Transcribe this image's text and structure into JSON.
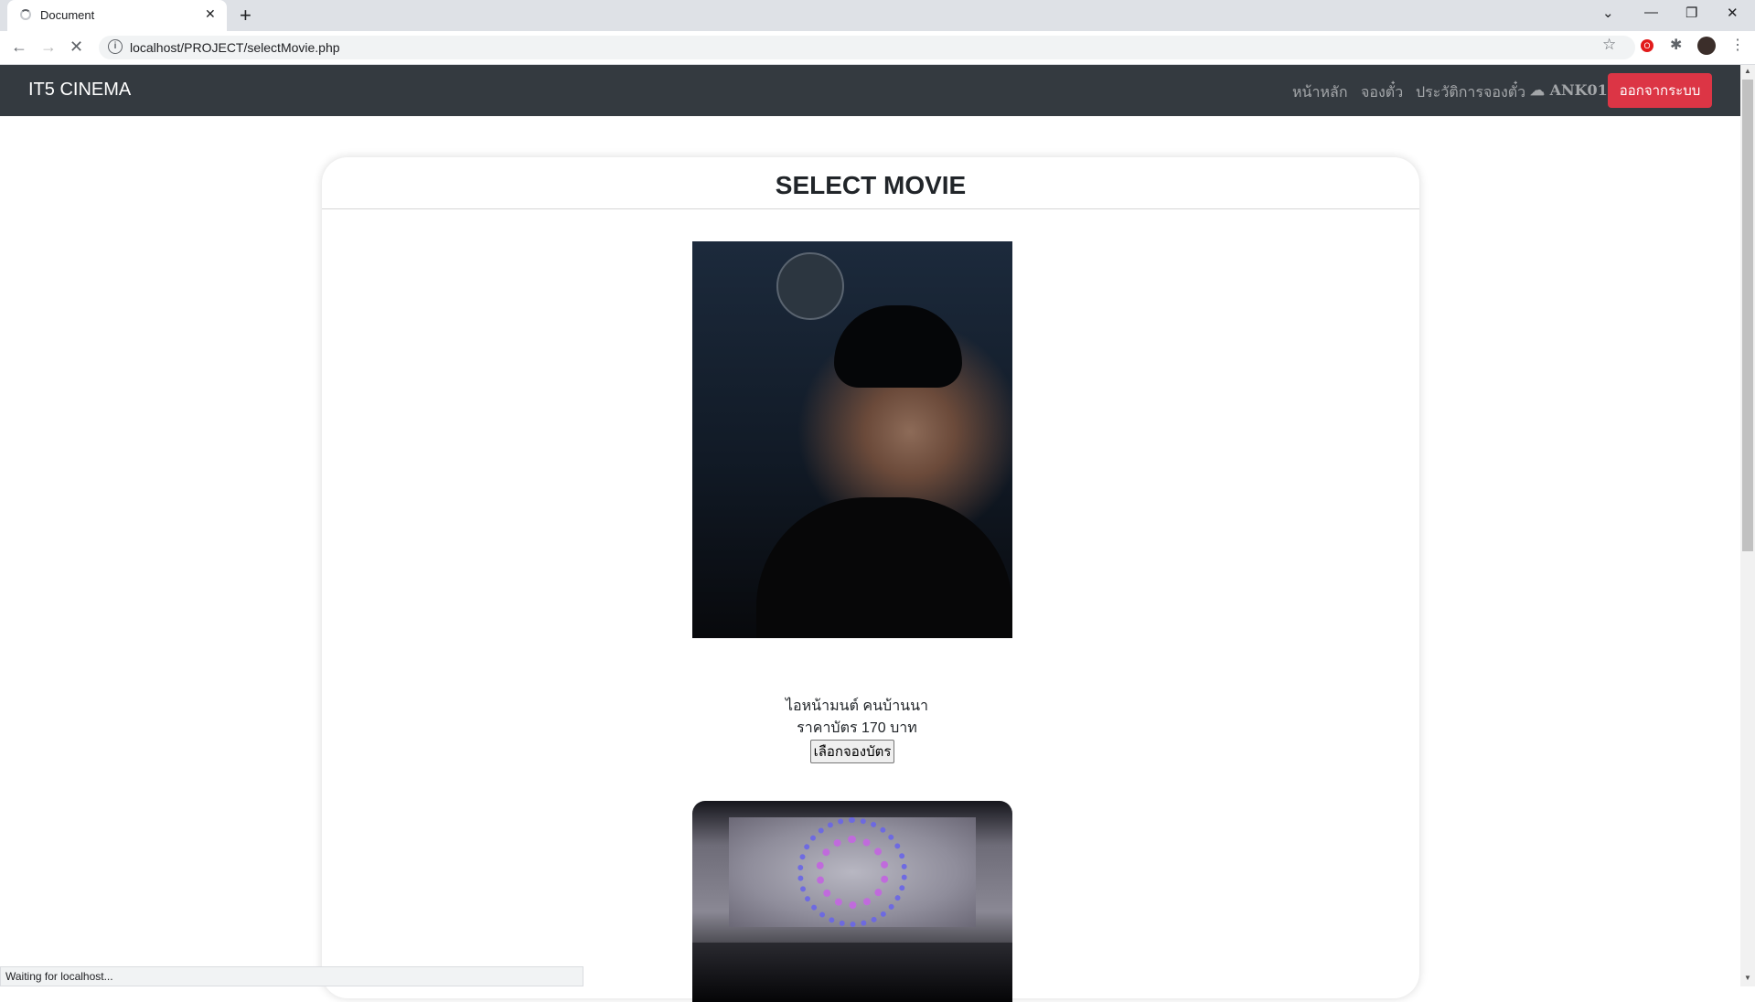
{
  "browser": {
    "tab_title": "Document",
    "url": "localhost/PROJECT/selectMovie.php",
    "status_text": "Waiting for localhost..."
  },
  "navbar": {
    "brand": "IT5 CINEMA",
    "links": [
      "หน้าหลัก",
      "จองตั๋ว",
      "ประวัติการจองตั๋ว"
    ],
    "user": "ANK01",
    "logout_label": "ออกจากระบบ"
  },
  "page": {
    "title": "SELECT MOVIE",
    "movies": [
      {
        "title": "ไอหน้ามนต์ คนบ้านนา",
        "price_text": "ราคาบัตร 170 บาท",
        "button_label": "เลือกจองบัตร"
      }
    ]
  },
  "colors": {
    "navbar_bg": "#343a40",
    "logout_bg": "#dc3545"
  }
}
